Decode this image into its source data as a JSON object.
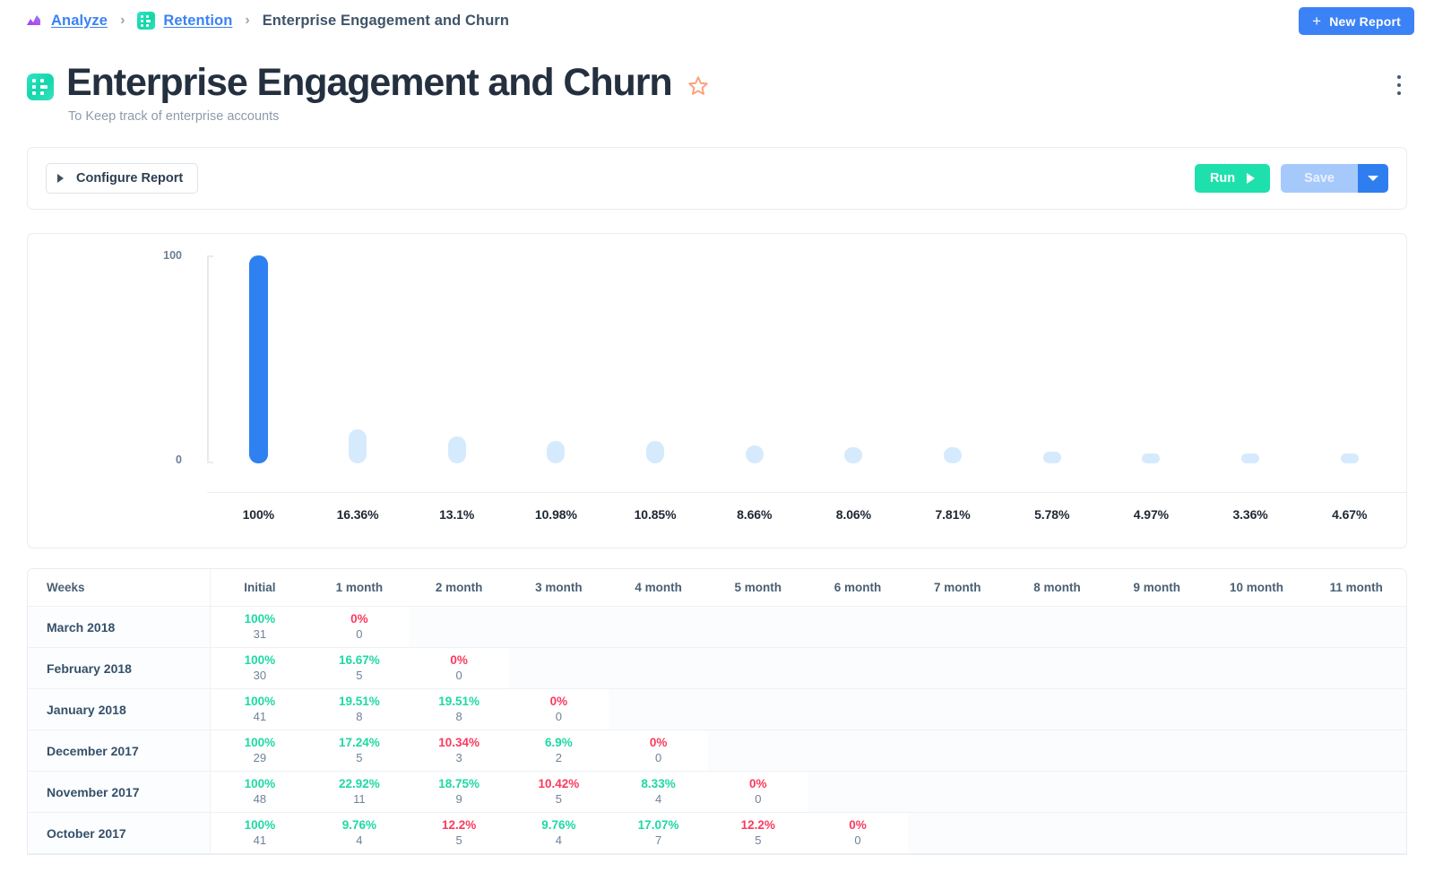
{
  "breadcrumb": {
    "root_label": "Analyze",
    "section_label": "Retention",
    "current_label": "Enterprise Engagement and Churn",
    "separator": "›",
    "root_icon": "area-chart-icon",
    "section_icon": "retention-grid-icon"
  },
  "topbar": {
    "new_report_label": "New Report",
    "new_report_plus": "+"
  },
  "header": {
    "title": "Enterprise Engagement and Churn",
    "subtitle": "To Keep track of enterprise accounts",
    "favorite_icon": "star-icon",
    "menu_icon": "kebab-menu-icon",
    "report_icon": "retention-grid-icon"
  },
  "configure": {
    "configure_label": "Configure Report",
    "expand_icon": "triangle-right-icon",
    "run_label": "Run",
    "run_icon": "play-icon",
    "save_label": "Save",
    "save_caret_icon": "chevron-down-icon"
  },
  "colors": {
    "accent_blue": "#3b82f6",
    "bar_primary": "#2f80f0",
    "bar_secondary": "#d6eafd",
    "run_green": "#1ee0ac",
    "pct_up": "#1ed9a4",
    "pct_down": "#fb3a5d",
    "title_ink": "#24303f"
  },
  "chart_data": {
    "type": "bar",
    "title": "",
    "xlabel": "",
    "ylabel": "",
    "ylim": [
      0,
      100
    ],
    "y_ticks": [
      "100",
      "0"
    ],
    "grid": false,
    "legend": null,
    "categories": [
      "Initial",
      "1 month",
      "2 month",
      "3 month",
      "4 month",
      "5 month",
      "6 month",
      "7 month",
      "8 month",
      "9 month",
      "10 month",
      "11 month"
    ],
    "labels": [
      "100%",
      "16.36%",
      "13.1%",
      "10.98%",
      "10.85%",
      "8.66%",
      "8.06%",
      "7.81%",
      "5.78%",
      "4.97%",
      "3.36%",
      "4.67%"
    ],
    "values": [
      100,
      16.36,
      13.1,
      10.98,
      10.85,
      8.66,
      8.06,
      7.81,
      5.78,
      4.97,
      3.36,
      4.67
    ]
  },
  "table": {
    "columns": [
      "Weeks",
      "Initial",
      "1 month",
      "2 month",
      "3 month",
      "4 month",
      "5 month",
      "6 month",
      "7 month",
      "8 month",
      "9 month",
      "10 month",
      "11 month"
    ],
    "rows": [
      {
        "week": "March 2018",
        "cells": [
          {
            "pct": "100%",
            "count": "31",
            "dir": "up"
          },
          {
            "pct": "0%",
            "count": "0",
            "dir": "down"
          },
          null,
          null,
          null,
          null,
          null,
          null,
          null,
          null,
          null,
          null
        ]
      },
      {
        "week": "February 2018",
        "cells": [
          {
            "pct": "100%",
            "count": "30",
            "dir": "up"
          },
          {
            "pct": "16.67%",
            "count": "5",
            "dir": "up"
          },
          {
            "pct": "0%",
            "count": "0",
            "dir": "down"
          },
          null,
          null,
          null,
          null,
          null,
          null,
          null,
          null,
          null
        ]
      },
      {
        "week": "January 2018",
        "cells": [
          {
            "pct": "100%",
            "count": "41",
            "dir": "up"
          },
          {
            "pct": "19.51%",
            "count": "8",
            "dir": "up"
          },
          {
            "pct": "19.51%",
            "count": "8",
            "dir": "up"
          },
          {
            "pct": "0%",
            "count": "0",
            "dir": "down"
          },
          null,
          null,
          null,
          null,
          null,
          null,
          null,
          null
        ]
      },
      {
        "week": "December 2017",
        "cells": [
          {
            "pct": "100%",
            "count": "29",
            "dir": "up"
          },
          {
            "pct": "17.24%",
            "count": "5",
            "dir": "up"
          },
          {
            "pct": "10.34%",
            "count": "3",
            "dir": "down"
          },
          {
            "pct": "6.9%",
            "count": "2",
            "dir": "up"
          },
          {
            "pct": "0%",
            "count": "0",
            "dir": "down"
          },
          null,
          null,
          null,
          null,
          null,
          null,
          null
        ]
      },
      {
        "week": "November 2017",
        "cells": [
          {
            "pct": "100%",
            "count": "48",
            "dir": "up"
          },
          {
            "pct": "22.92%",
            "count": "11",
            "dir": "up"
          },
          {
            "pct": "18.75%",
            "count": "9",
            "dir": "up"
          },
          {
            "pct": "10.42%",
            "count": "5",
            "dir": "down"
          },
          {
            "pct": "8.33%",
            "count": "4",
            "dir": "up"
          },
          {
            "pct": "0%",
            "count": "0",
            "dir": "down"
          },
          null,
          null,
          null,
          null,
          null,
          null
        ]
      },
      {
        "week": "October 2017",
        "cells": [
          {
            "pct": "100%",
            "count": "41",
            "dir": "up"
          },
          {
            "pct": "9.76%",
            "count": "4",
            "dir": "up"
          },
          {
            "pct": "12.2%",
            "count": "5",
            "dir": "down"
          },
          {
            "pct": "9.76%",
            "count": "4",
            "dir": "up"
          },
          {
            "pct": "17.07%",
            "count": "7",
            "dir": "up"
          },
          {
            "pct": "12.2%",
            "count": "5",
            "dir": "down"
          },
          {
            "pct": "0%",
            "count": "0",
            "dir": "down"
          },
          null,
          null,
          null,
          null,
          null
        ]
      }
    ]
  }
}
